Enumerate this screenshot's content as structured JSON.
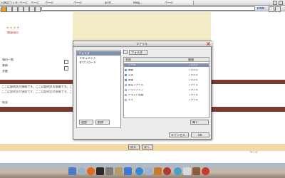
{
  "browser": {
    "tabs": [
      {
        "label": "日本語の…"
      },
      {
        "label": "ウィキペディア"
      },
      {
        "label": "ページ"
      },
      {
        "label": "ページ"
      },
      {
        "label": "ページ"
      },
      {
        "label": "ページ"
      },
      {
        "label": "Jicnt…"
      },
      {
        "label": "Blog…"
      },
      {
        "label": "ページ"
      }
    ],
    "toolbar_right_label": "DRM"
  },
  "page": {
    "header": "関連項目",
    "section_heading": "概要",
    "side_labels": [
      "項目一覧",
      "参照",
      "文献"
    ],
    "body_text": "ここは説明文の領域です。ここは説明文の領域です。ここは説明文の領域です。",
    "footer_buttons": [
      {
        "label": "戻る"
      },
      {
        "label": "次へ"
      }
    ],
    "footer_right_label": "ページ"
  },
  "dialog": {
    "title": "ファイル",
    "tree": {
      "root": "フォルダ",
      "items": [
        "ドキュメント",
        "ダウンロード"
      ]
    },
    "tree_buttons": [
      {
        "label": "追加"
      },
      {
        "label": "削除"
      }
    ],
    "toolbar_button": "フォルダ",
    "table": {
      "columns": [
        "名前",
        "種類"
      ],
      "rows": [
        {
          "name": "データ",
          "type": "フォルダ"
        },
        {
          "name": "画像",
          "type": "フォルダ"
        },
        {
          "name": "文書",
          "type": "フォルダ"
        },
        {
          "name": "音楽",
          "type": "フォルダ"
        },
        {
          "name": "設定ファイル",
          "type": "ファイル"
        },
        {
          "name": "バックアップ",
          "type": "ファイル"
        },
        {
          "name": "テキスト書類",
          "type": "ファイル"
        },
        {
          "name": "メモ",
          "type": "ファイル"
        }
      ]
    },
    "right_button": "開く",
    "bottom_buttons": [
      {
        "label": "キャンセル"
      },
      {
        "label": "OK"
      }
    ]
  },
  "colors": {
    "brown_band": "#7a3b2e",
    "cream": "#f3ecc6",
    "selection": "#7f8fae",
    "accent_red": "#c0392b"
  },
  "dock": {
    "icons": [
      "finder-icon",
      "system-icon",
      "firefox-icon",
      "terminal-icon",
      "network-icon",
      "folder-icon",
      "blue-app-icon",
      "browser-icon",
      "mail-icon",
      "photo-icon",
      "game-icon",
      "globe-icon"
    ]
  }
}
